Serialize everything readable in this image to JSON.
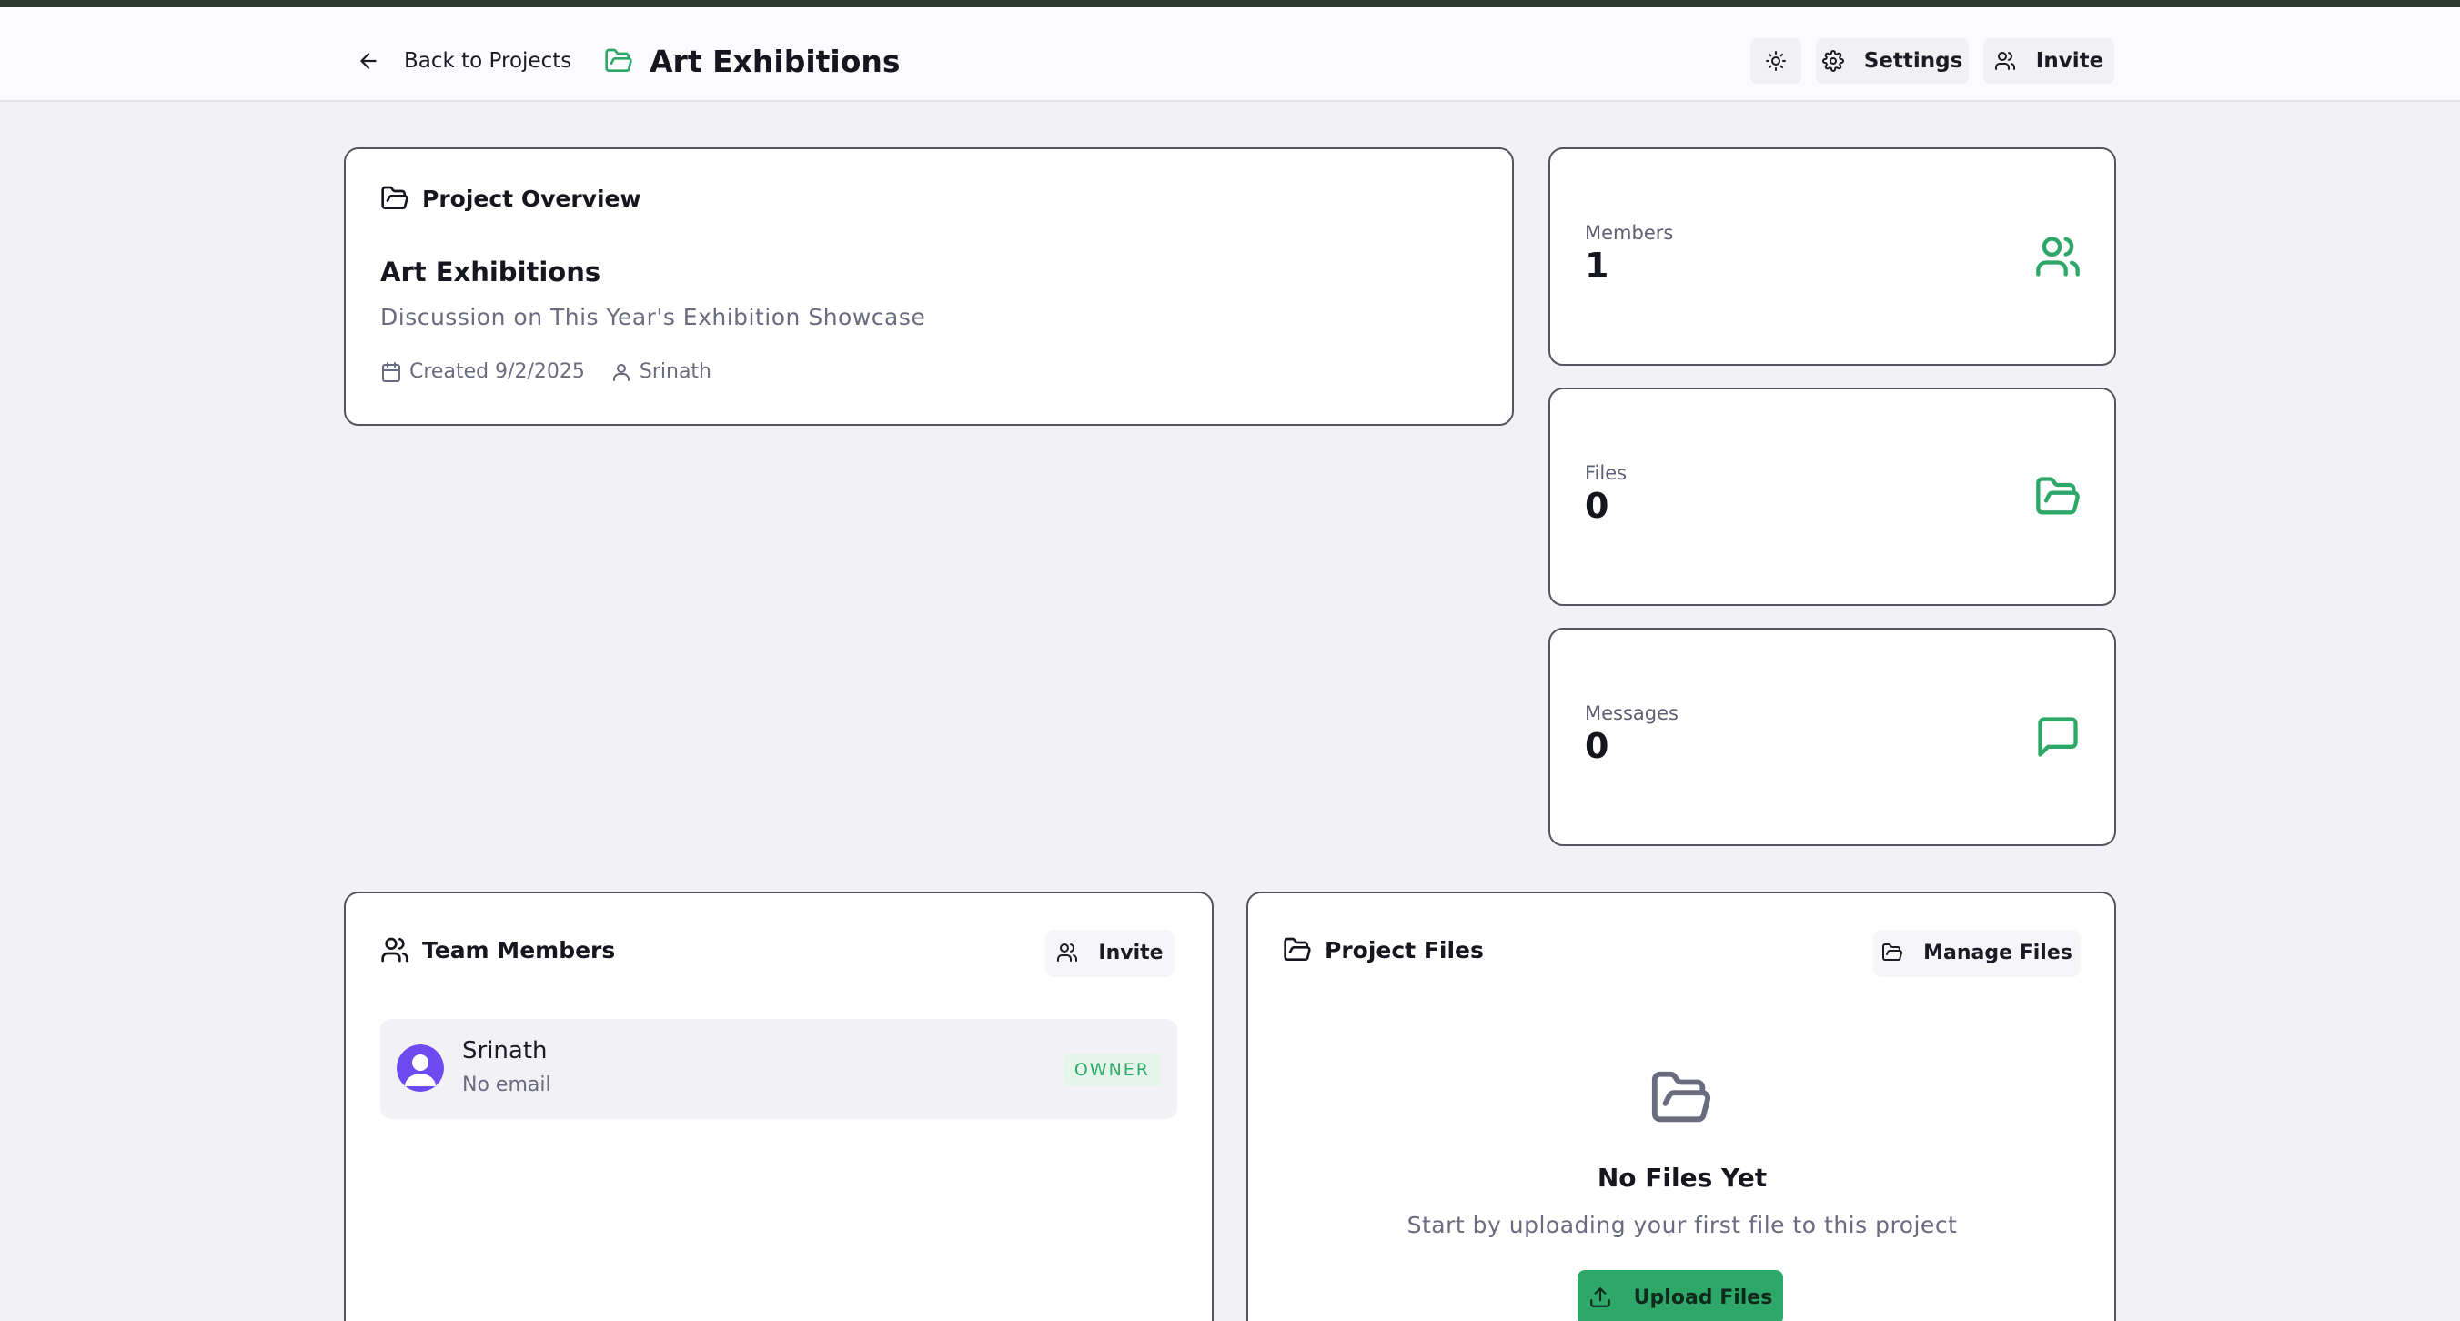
{
  "colors": {
    "accent": "#2ea869",
    "top_bar": "#2e3b2e",
    "background": "#f2f2f6",
    "avatar": "#6c4cf1"
  },
  "header": {
    "back_label": "Back to Projects",
    "title": "Art Exhibitions",
    "settings_label": "Settings",
    "invite_label": "Invite",
    "icons": [
      "arrow-left-icon",
      "folder-open-icon",
      "sun-icon",
      "gear-icon",
      "users-icon"
    ]
  },
  "overview": {
    "heading": "Project Overview",
    "name": "Art Exhibitions",
    "description": "Discussion on This Year's Exhibition Showcase",
    "created": "Created 9/2/2025",
    "owner": "Srinath"
  },
  "stats": {
    "members": {
      "label": "Members",
      "value": "1"
    },
    "files": {
      "label": "Files",
      "value": "0"
    },
    "messages": {
      "label": "Messages",
      "value": "0"
    }
  },
  "team": {
    "heading": "Team Members",
    "invite_label": "Invite",
    "members": [
      {
        "name": "Srinath",
        "email": "No email",
        "role": "OWNER"
      }
    ]
  },
  "files": {
    "heading": "Project Files",
    "manage_label": "Manage Files",
    "empty_title": "No Files Yet",
    "empty_subtitle": "Start by uploading your first file to this project",
    "upload_label": "Upload Files"
  }
}
